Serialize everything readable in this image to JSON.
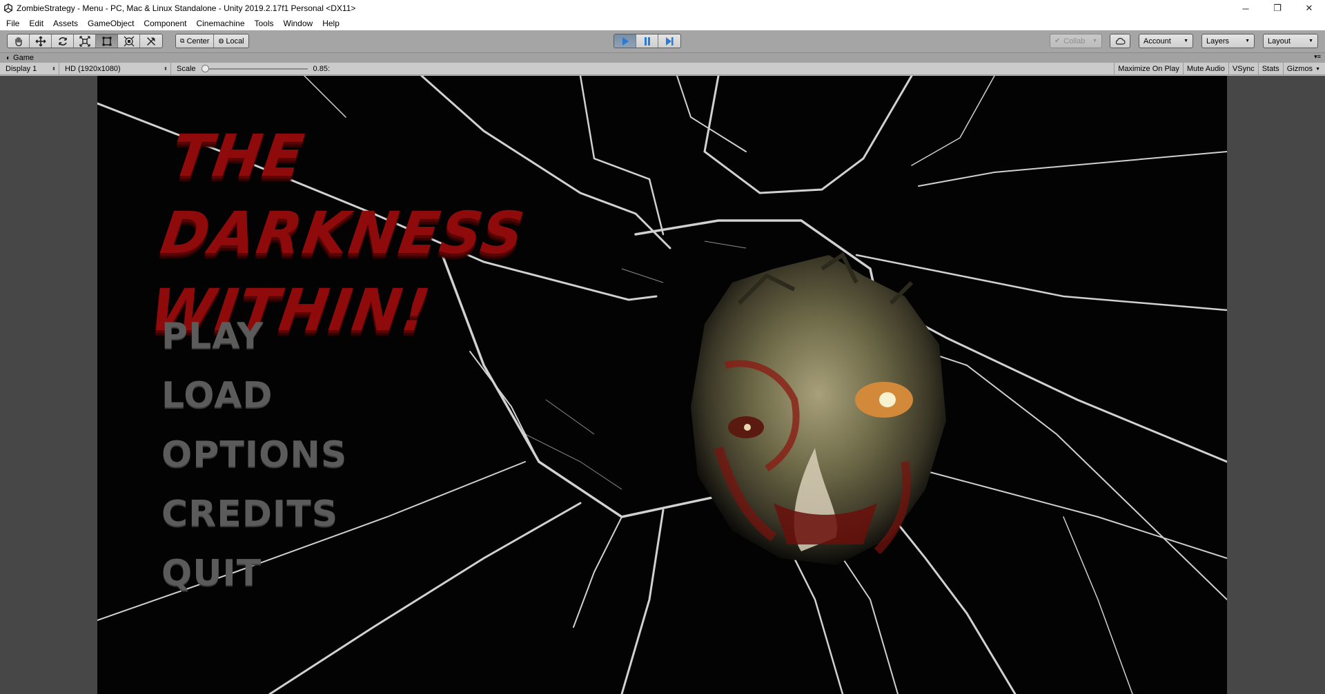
{
  "window": {
    "title": "ZombieStrategy - Menu - PC, Mac & Linux Standalone - Unity 2019.2.17f1 Personal <DX11>",
    "controls": {
      "minimize": "─",
      "restore": "❐",
      "close": "✕"
    }
  },
  "menubar": {
    "items": [
      "File",
      "Edit",
      "Assets",
      "GameObject",
      "Component",
      "Cinemachine",
      "Tools",
      "Window",
      "Help"
    ]
  },
  "toolbar": {
    "transform_tools": [
      "hand-icon",
      "move-icon",
      "rotate-icon",
      "scale-icon",
      "rect-icon",
      "transform-icon",
      "custom-tool-icon"
    ],
    "active_tool": "rect-icon",
    "pivot": {
      "center_label": "Center",
      "local_label": "Local"
    },
    "play_controls": {
      "play_active": true
    },
    "collab_label": "Collab",
    "account_label": "Account",
    "layers_label": "Layers",
    "layout_label": "Layout"
  },
  "game_tab": {
    "label": "Game"
  },
  "game_toolbar": {
    "display": "Display 1",
    "resolution": "HD (1920x1080)",
    "scale_label": "Scale",
    "scale_value": "0.85:",
    "scale_slider_fraction": 0.0,
    "toggles": [
      "Maximize On Play",
      "Mute Audio",
      "VSync",
      "Stats",
      "Gizmos"
    ]
  },
  "game": {
    "title_line1": "The Darkness",
    "title_line2": "Within!",
    "menu_options": [
      "PLAY",
      "LOAD",
      "OPTIONS",
      "CREDITS",
      "QUIT"
    ],
    "title_color": "#8f0b0b",
    "menu_color": "#5b5b5b"
  },
  "colors": {
    "play_accent": "#2a7ad6",
    "editor_toolbar": "#a5a5a5",
    "game_background": "#474747"
  }
}
